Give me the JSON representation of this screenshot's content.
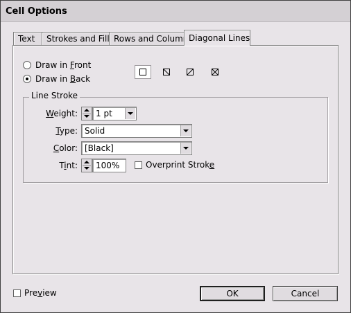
{
  "window": {
    "title": "Cell Options"
  },
  "tabs": [
    {
      "label": "Text"
    },
    {
      "label": "Strokes and Fills"
    },
    {
      "label": "Rows and Columns"
    },
    {
      "label": "Diagonal Lines",
      "active": true
    }
  ],
  "draw_order": {
    "front_pre": "Draw in ",
    "front_key": "F",
    "front_post": "ront",
    "back_pre": "Draw in ",
    "back_key": "B",
    "back_post": "ack",
    "selected": "back"
  },
  "diagonal_buttons": [
    {
      "icon": "no-diagonal-icon",
      "selected": true
    },
    {
      "icon": "diagonal-down-icon"
    },
    {
      "icon": "diagonal-up-icon"
    },
    {
      "icon": "diagonal-both-icon"
    }
  ],
  "line_stroke": {
    "legend": "Line Stroke",
    "weight": {
      "key": "W",
      "rest": "eight:",
      "value": "1 pt"
    },
    "type": {
      "key": "T",
      "rest": "ype:",
      "value": "Solid"
    },
    "color": {
      "key": "C",
      "rest": "olor:",
      "value": "[Black]"
    },
    "tint": {
      "pre": "T",
      "key": "i",
      "rest": "nt:",
      "value": "100%"
    },
    "overprint": {
      "pre": "Overprint Strok",
      "key": "e",
      "checked": false
    }
  },
  "footer": {
    "preview": {
      "pre": "Pre",
      "key": "v",
      "post": "iew",
      "checked": false
    },
    "ok_label": "OK",
    "cancel_label": "Cancel"
  }
}
